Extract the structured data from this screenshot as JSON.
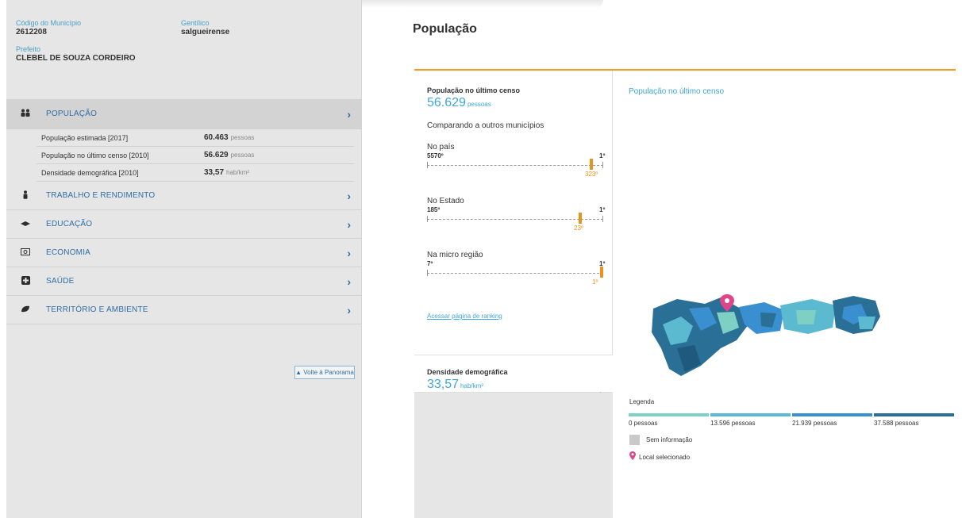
{
  "sidebar": {
    "municipio_label": "Código do Município",
    "municipio_value": "2612208",
    "gentilico_label": "Gentílico",
    "gentilico_value": "salgueirense",
    "prefeito_label": "Prefeito",
    "prefeito_value": "CLEBEL DE SOUZA CORDEIRO",
    "topics": [
      {
        "label": "POPULAÇÃO",
        "icon": "people-icon"
      },
      {
        "label": "TRABALHO E RENDIMENTO",
        "icon": "person-icon"
      },
      {
        "label": "EDUCAÇÃO",
        "icon": "book-icon"
      },
      {
        "label": "ECONOMIA",
        "icon": "money-icon"
      },
      {
        "label": "SAÚDE",
        "icon": "health-icon"
      },
      {
        "label": "TERRITÓRIO E AMBIENTE",
        "icon": "leaf-icon"
      }
    ],
    "population_rows": [
      {
        "label": "População estimada [2017]",
        "value": "60.463",
        "unit": "pessoas"
      },
      {
        "label": "População no último censo [2010]",
        "value": "56.629",
        "unit": "pessoas"
      },
      {
        "label": "Densidade demográfica [2010]",
        "value": "33,57",
        "unit": "hab/km²"
      }
    ],
    "chevron": "›",
    "back_button": "▲ Volte à Panorama"
  },
  "main": {
    "title": "População",
    "census_label": "População no último censo",
    "census_value": "56.629",
    "census_unit": "pessoas",
    "compare_label": "Comparando a outros municípios",
    "rankings": [
      {
        "title": "No país",
        "left": "5570º",
        "right": "1º",
        "position": "323º",
        "fraction": 0.942
      },
      {
        "title": "No Estado",
        "left": "185º",
        "right": "1º",
        "position": "23º",
        "fraction": 0.88
      },
      {
        "title": "Na micro região",
        "left": "7º",
        "right": "1º",
        "position": "1º",
        "fraction": 1.0
      }
    ],
    "page_link": "Acessar página de ranking",
    "density_label": "Densidade demográfica",
    "density_value": "33,57",
    "density_unit": "hab/km²",
    "density_chevron": "›",
    "map_title": "População no último censo",
    "legend_title": "Legenda",
    "legend_values": [
      "0 pessoas",
      "13.596 pessoas",
      "21.939 pessoas",
      "37.588 pessoas"
    ],
    "legend_colors": [
      "#7fd0c4",
      "#5bbad0",
      "#3a8fd0",
      "#2a6f96"
    ],
    "no_info_label": "Sem informação",
    "selected_label": "Local selecionado"
  }
}
